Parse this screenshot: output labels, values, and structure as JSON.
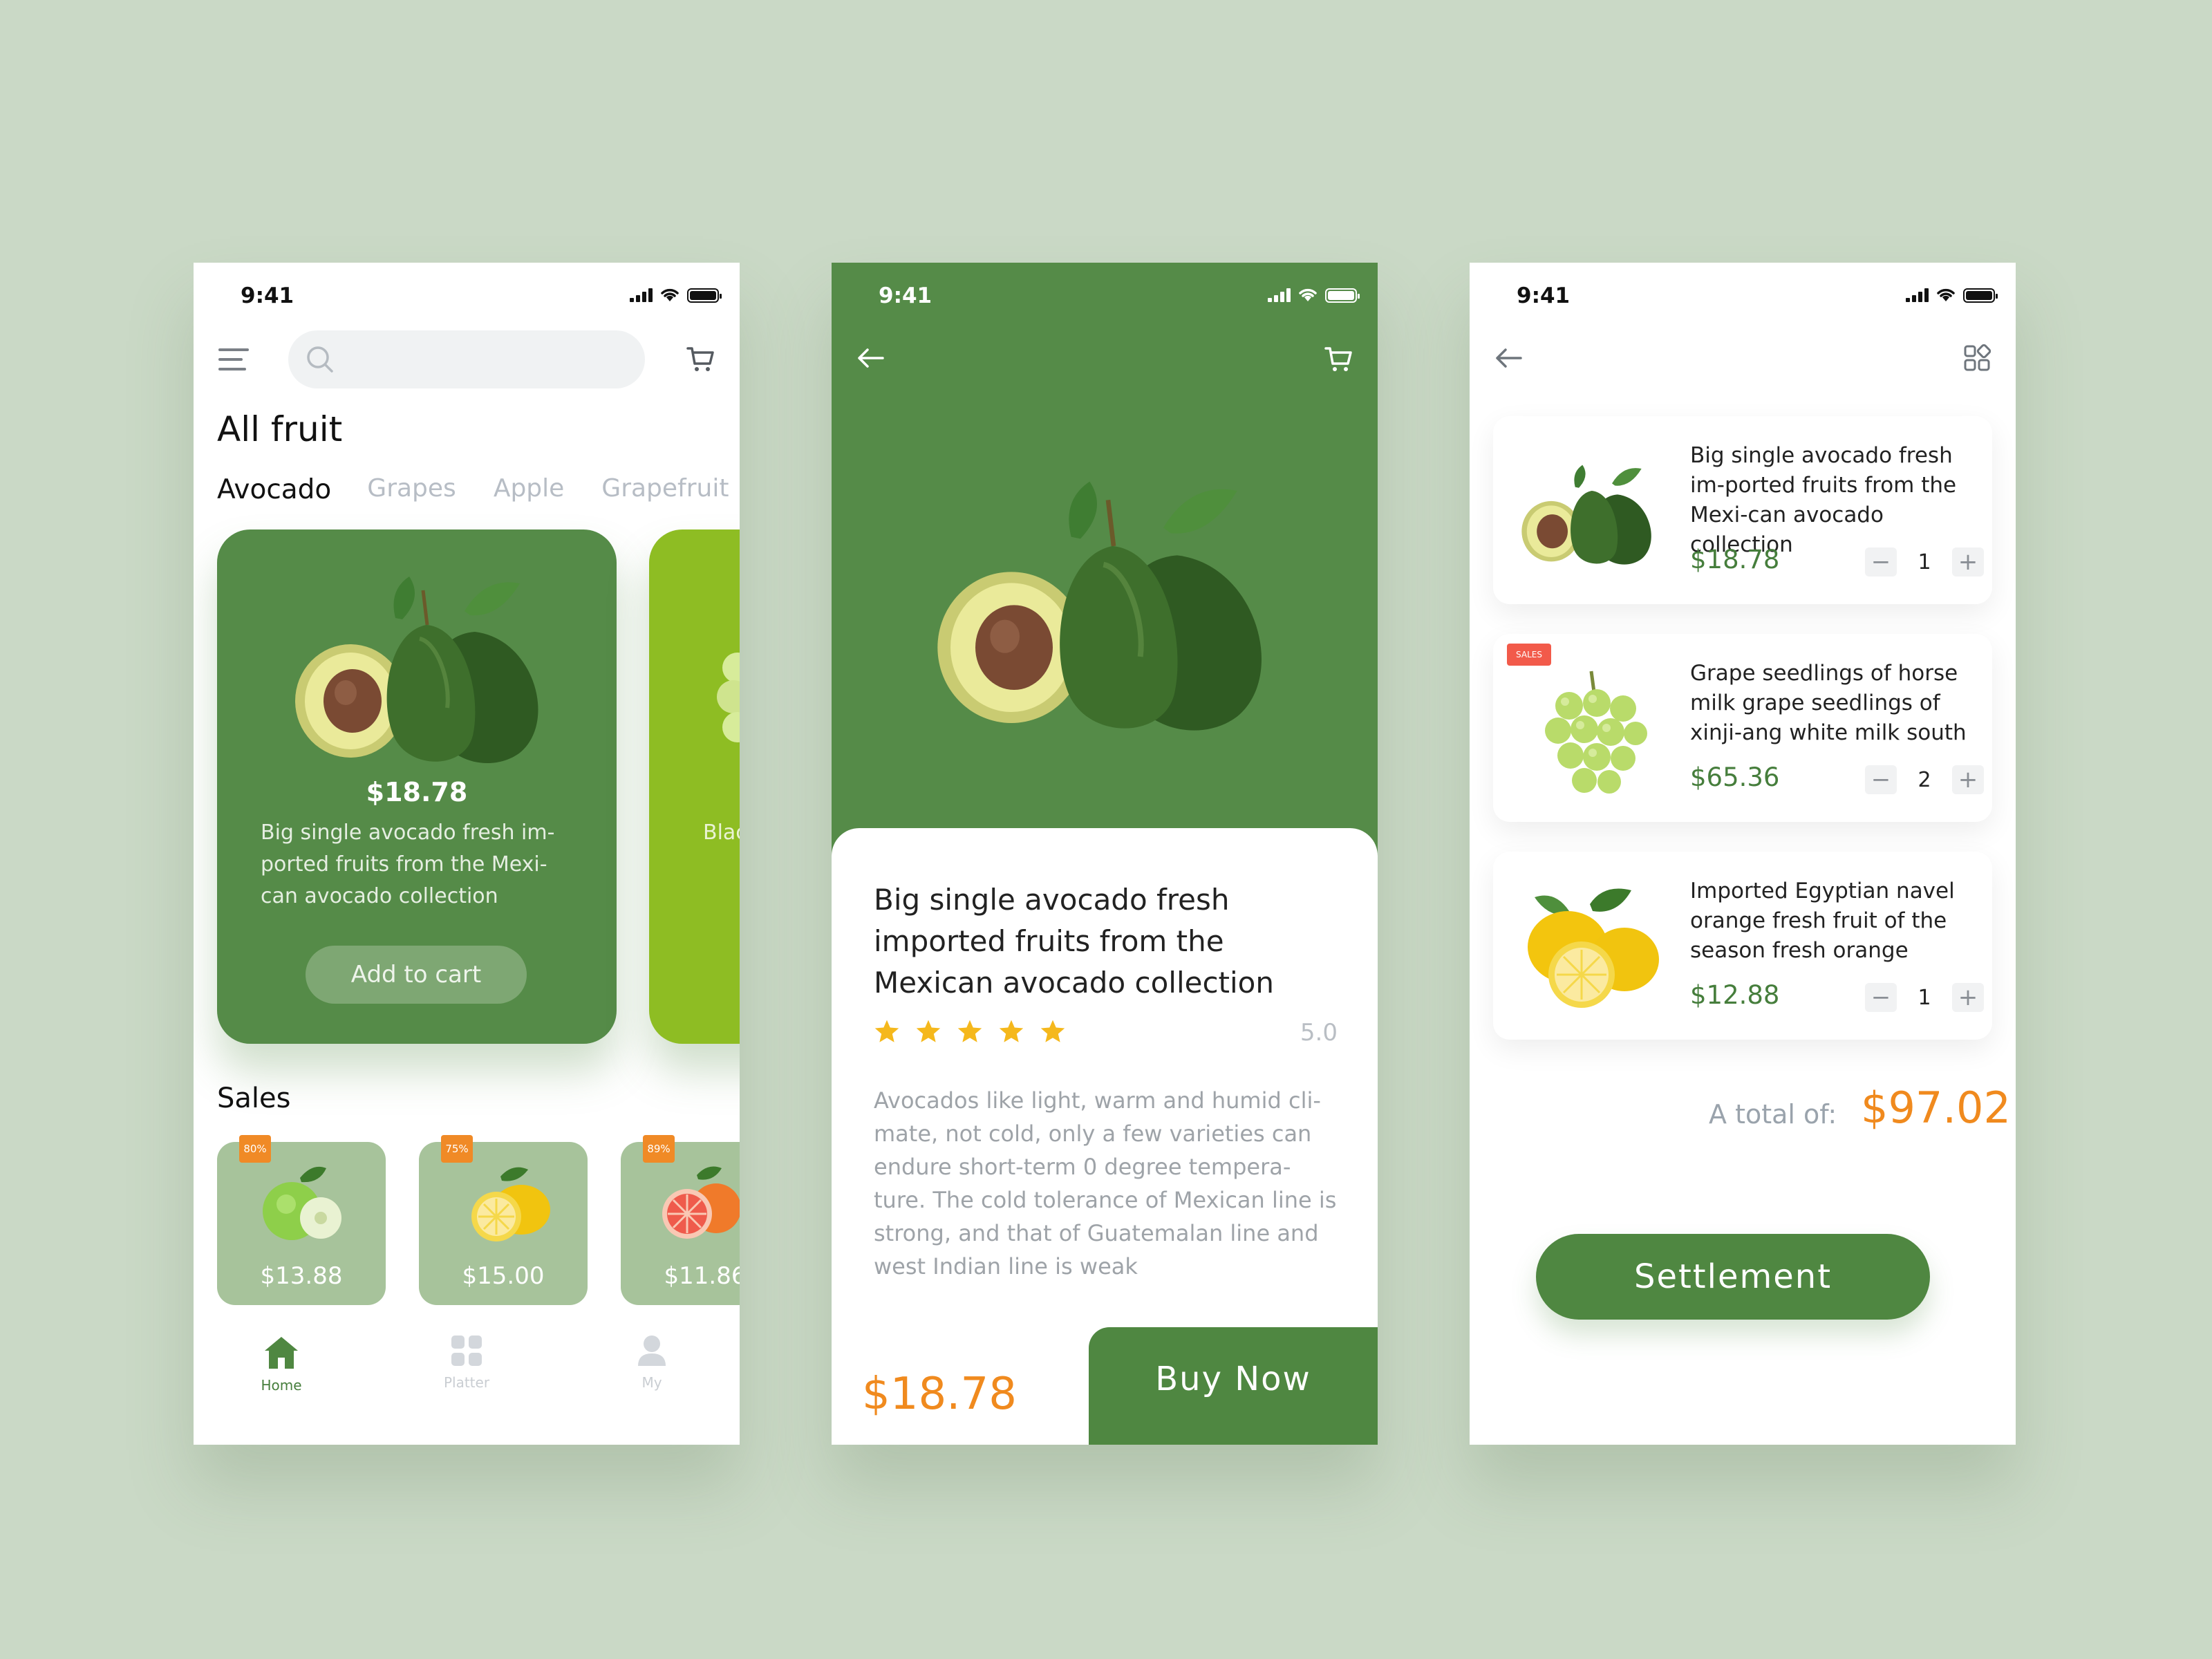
{
  "colors": {
    "background": "#cad9c6",
    "primary_green": "#558b48",
    "accent_orange": "#f08a1e",
    "lime_card": "#8ebd23",
    "sale_card": "#a7c39b"
  },
  "status": {
    "time": "9:41"
  },
  "home": {
    "search": {
      "placeholder": ""
    },
    "title": "All fruit",
    "categories": [
      "Avocado",
      "Grapes",
      "Apple",
      "Grapefruit"
    ],
    "featured": {
      "price": "$18.78",
      "description": "Big single avocado fresh im-ported fruits from the Mexi-can avocado collection",
      "button": "Add to cart"
    },
    "next_card_text": "Blac cial of x",
    "sales_title": "Sales",
    "sales": [
      {
        "badge": "80%",
        "price": "$13.88",
        "icon": "apple-icon"
      },
      {
        "badge": "75%",
        "price": "$15.00",
        "icon": "lemon-icon"
      },
      {
        "badge": "89%",
        "price": "$11.86",
        "icon": "grapefruit-icon"
      }
    ],
    "tabs": [
      {
        "label": "Home",
        "icon": "home-icon"
      },
      {
        "label": "Platter",
        "icon": "grid-icon"
      },
      {
        "label": "My",
        "icon": "user-icon"
      }
    ]
  },
  "detail": {
    "name": "Big single avocado fresh imported fruits from the Mexican avocado collection",
    "stars": 5,
    "rating": "5.0",
    "description": "Avocados like light, warm and humid cli-mate, not cold, only a few varieties can endure short-term 0 degree tempera-ture. The cold tolerance of Mexican line is strong, and that of Guatemalan line and west Indian line is weak",
    "price": "$18.78",
    "buy_label": "Buy  Now"
  },
  "cart": {
    "items": [
      {
        "name": "Big single avocado fresh im-ported fruits from the Mexi-can avocado collection",
        "price": "$18.78",
        "qty": "1",
        "tag": ""
      },
      {
        "name": "Grape seedlings of horse milk grape seedlings of xinji-ang white milk south",
        "price": "$65.36",
        "qty": "2",
        "tag": "SALES"
      },
      {
        "name": "Imported Egyptian navel orange fresh fruit of the season fresh orange",
        "price": "$12.88",
        "qty": "1",
        "tag": ""
      }
    ],
    "minus": "−",
    "plus": "+",
    "total_label": "A total of:",
    "total": "$97.02",
    "settle_label": "Settlement"
  }
}
